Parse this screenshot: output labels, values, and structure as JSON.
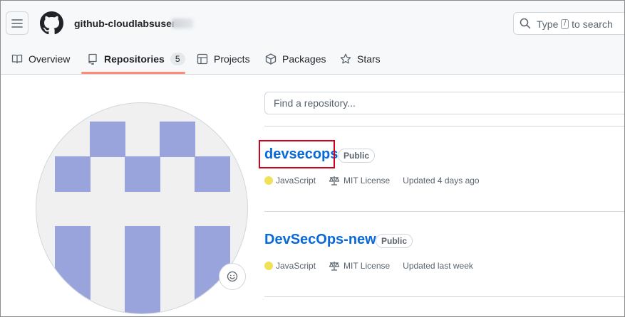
{
  "header": {
    "username": "github-cloudlabsuser-",
    "search_placeholder_pre": "Type",
    "search_key": "/",
    "search_placeholder_post": "to search"
  },
  "nav": {
    "tabs": [
      {
        "label": "Overview",
        "icon": "book-icon"
      },
      {
        "label": "Repositories",
        "icon": "repo-icon",
        "count": "5",
        "active": true
      },
      {
        "label": "Projects",
        "icon": "table-icon"
      },
      {
        "label": "Packages",
        "icon": "package-icon"
      },
      {
        "label": "Stars",
        "icon": "star-icon"
      }
    ]
  },
  "repos": {
    "find_placeholder": "Find a repository...",
    "items": [
      {
        "name": "devsecops",
        "visibility": "Public",
        "language": "JavaScript",
        "language_color": "#f1e05a",
        "license": "MIT License",
        "updated": "Updated 4 days ago",
        "highlighted": true
      },
      {
        "name": "DevSecOps-new",
        "visibility": "Public",
        "language": "JavaScript",
        "language_color": "#f1e05a",
        "license": "MIT License",
        "updated": "Updated last week",
        "highlighted": false
      }
    ]
  },
  "colors": {
    "accent_underline": "#fd8c73",
    "link": "#0969da",
    "identicon": "#9aa4dc",
    "highlight": "#d0021b"
  }
}
